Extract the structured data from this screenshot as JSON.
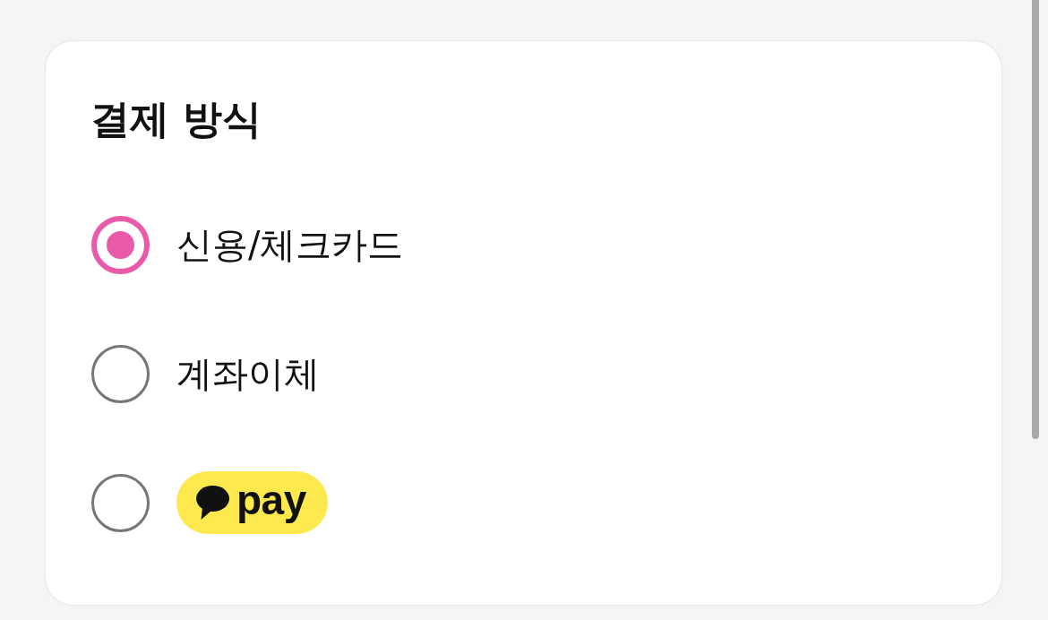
{
  "payment_section": {
    "title": "결제 방식",
    "options": [
      {
        "kind": "text",
        "label": "신용/체크카드",
        "selected": true
      },
      {
        "kind": "text",
        "label": "계좌이체",
        "selected": false
      },
      {
        "kind": "logo",
        "label": "pay",
        "selected": false
      }
    ]
  }
}
